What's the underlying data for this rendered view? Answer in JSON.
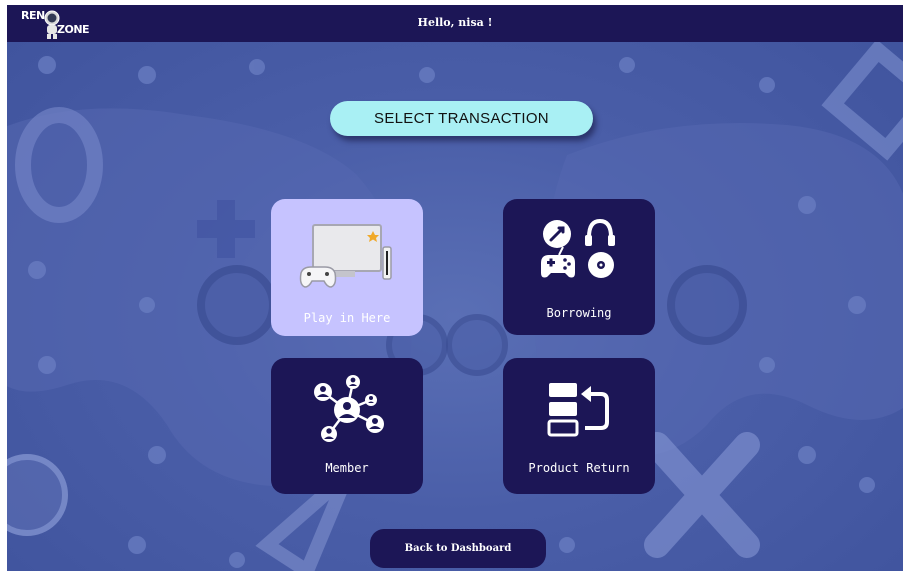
{
  "header": {
    "logo_top": "REN",
    "logo_bottom": "ZONE",
    "greeting": "Hello, nisa !"
  },
  "title": "SELECT TRANSACTION",
  "cards": [
    {
      "label": "Play in Here",
      "icon": "tv-console-icon",
      "selected": true
    },
    {
      "label": "Borrowing",
      "icon": "borrow-items-icon",
      "selected": false
    },
    {
      "label": "Member",
      "icon": "member-network-icon",
      "selected": false
    },
    {
      "label": "Product Return",
      "icon": "product-return-icon",
      "selected": false
    }
  ],
  "back_button": "Back to Dashboard",
  "colors": {
    "navy": "#1c1656",
    "selected_card": "#c6c3ff",
    "title_pill": "#a9f0f4",
    "background": "#4a5ea8"
  }
}
